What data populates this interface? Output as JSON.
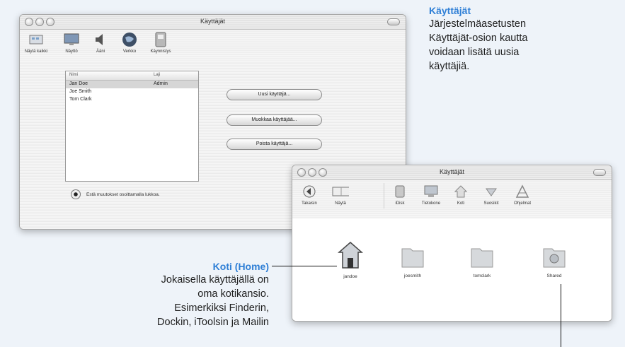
{
  "window_users": {
    "title": "Käyttäjät",
    "toolbar": [
      {
        "label": "Näytä kaikki",
        "icon": "show-all-icon"
      },
      {
        "label": "Näyttö",
        "icon": "display-icon"
      },
      {
        "label": "Ääni",
        "icon": "sound-icon"
      },
      {
        "label": "Verkko",
        "icon": "network-icon"
      },
      {
        "label": "Käynnistys",
        "icon": "startup-disk-icon"
      }
    ],
    "columns": {
      "name": "Nimi",
      "kind": "Laji"
    },
    "rows": [
      {
        "name": "Jan Doe",
        "kind": "Admin"
      },
      {
        "name": "Joe Smith",
        "kind": ""
      },
      {
        "name": "Tom Clark",
        "kind": ""
      }
    ],
    "buttons": {
      "new_user": "Uusi käyttäjä...",
      "edit_user": "Muokkaa käyttäjää...",
      "delete_user": "Poista käyttäjä..."
    },
    "lock_text": "Estä muutokset osoittamalla lukkoa."
  },
  "window_finder": {
    "title": "Käyttäjät",
    "toolbar": [
      {
        "label": "Takaisin",
        "icon": "back-icon"
      },
      {
        "label": "Näytä",
        "icon": "view-icon"
      },
      {
        "label": "iDisk",
        "icon": "idisk-icon"
      },
      {
        "label": "Tietokone",
        "icon": "computer-icon"
      },
      {
        "label": "Koti",
        "icon": "home-icon"
      },
      {
        "label": "Suosikit",
        "icon": "favorites-icon"
      },
      {
        "label": "Ohjelmat",
        "icon": "applications-icon"
      }
    ],
    "folders": [
      {
        "label": "jandoe",
        "icon": "home-folder-icon"
      },
      {
        "label": "joesmith",
        "icon": "folder-icon"
      },
      {
        "label": "tomclark",
        "icon": "folder-icon"
      },
      {
        "label": "Shared",
        "icon": "shared-folder-icon"
      }
    ]
  },
  "note_users": {
    "heading": "Käyttäjät",
    "lines": [
      "Järjestelmäasetusten",
      "Käyttäjät-osion kautta",
      "voidaan lisätä uusia",
      "käyttäjiä."
    ]
  },
  "note_home": {
    "heading": "Koti (Home)",
    "lines": [
      "Jokaisella käyttäjällä on",
      "oma kotikansio.",
      "Esimerkiksi Finderin,",
      "Dockin, iToolsin ja Mailin"
    ]
  },
  "colors": {
    "accent": "#2f7fd6",
    "background": "#eef3f9"
  }
}
